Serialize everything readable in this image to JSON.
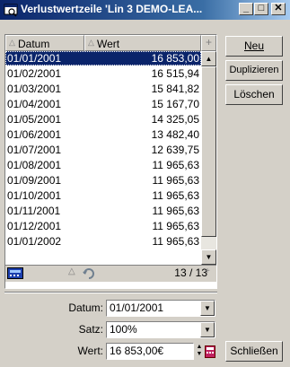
{
  "window": {
    "title": "Verlustwertzeile 'Lin 3 DEMO-LEA...",
    "minimize_glyph": "_",
    "maximize_glyph": "□",
    "close_glyph": "✕"
  },
  "grid": {
    "columns": [
      "Datum",
      "Wert"
    ],
    "rows": [
      {
        "datum": "01/01/2001",
        "wert": "16 853,00"
      },
      {
        "datum": "01/02/2001",
        "wert": "16 515,94"
      },
      {
        "datum": "01/03/2001",
        "wert": "15 841,82"
      },
      {
        "datum": "01/04/2001",
        "wert": "15 167,70"
      },
      {
        "datum": "01/05/2001",
        "wert": "14 325,05"
      },
      {
        "datum": "01/06/2001",
        "wert": "13 482,40"
      },
      {
        "datum": "01/07/2001",
        "wert": "12 639,75"
      },
      {
        "datum": "01/08/2001",
        "wert": "11 965,63"
      },
      {
        "datum": "01/09/2001",
        "wert": "11 965,63"
      },
      {
        "datum": "01/10/2001",
        "wert": "11 965,63"
      },
      {
        "datum": "01/11/2001",
        "wert": "11 965,63"
      },
      {
        "datum": "01/12/2001",
        "wert": "11 965,63"
      },
      {
        "datum": "01/01/2002",
        "wert": "11 965,63"
      }
    ],
    "selected_index": 0,
    "record_counter": "13 / 13",
    "add_column_glyph": "+"
  },
  "buttons": {
    "new": "Neu",
    "duplicate": "Duplizieren",
    "delete": "Löschen",
    "close": "Schließen"
  },
  "form": {
    "datum_label": "Datum:",
    "datum_value": "01/01/2001",
    "satz_label": "Satz:",
    "satz_value": "100%",
    "wert_label": "Wert:",
    "wert_value": "16 853,00€"
  },
  "colors": {
    "selection": "#0a246a",
    "titlebar": "#0a246a",
    "face": "#d4d0c8"
  }
}
